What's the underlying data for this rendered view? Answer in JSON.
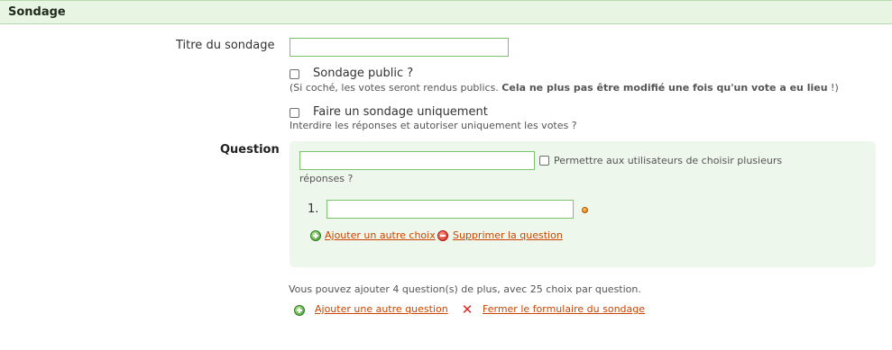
{
  "header": {
    "title": "Sondage"
  },
  "poll": {
    "title_label": "Titre du sondage",
    "title_value": "",
    "public_label": "Sondage public ?",
    "public_hint_prefix": "(Si coché, les votes seront rendus publics. ",
    "public_hint_bold": "Cela ne plus pas être modifié une fois qu'un vote a eu lieu",
    "public_hint_suffix": " !)",
    "only_poll_label": "Faire un sondage uniquement",
    "only_poll_hint": "Interdire les réponses et autoriser uniquement les votes ?"
  },
  "question": {
    "label": "Question",
    "value": "",
    "multiple_label_line1": "Permettre aux utilisateurs de choisir plusieurs",
    "multiple_label_line2": "réponses ?",
    "choices": [
      {
        "number": "1.",
        "value": ""
      }
    ],
    "add_choice_label": "Ajouter un autre choix",
    "remove_question_label": "Supprimer la question"
  },
  "footer": {
    "info_text": "Vous pouvez ajouter 4 question(s) de plus, avec 25 choix par question.",
    "add_question_label": "Ajouter une autre question",
    "close_form_label": "Fermer le formulaire du sondage"
  },
  "icons": {
    "add": "add-circle-icon",
    "remove": "remove-circle-icon",
    "close": "close-x-icon",
    "choice_status": "status-dot-icon"
  },
  "colors": {
    "header_bg": "#e8f5e2",
    "panel_bg": "#eef7eb",
    "input_border": "#7cc26b",
    "link": "#cc4400"
  }
}
